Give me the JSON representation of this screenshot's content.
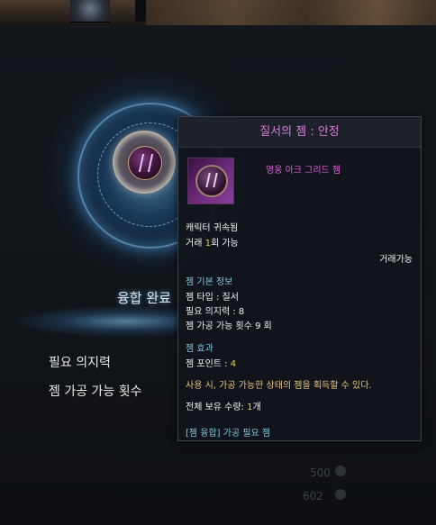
{
  "background": {
    "fusion_status": "융합 완료",
    "stats": [
      "필요 의지력",
      "젬 가공 가능 횟수"
    ],
    "faint_values": [
      "500",
      "602"
    ]
  },
  "tooltip": {
    "title": "질서의 젬 : 안정",
    "grade": "영웅 아크 그리드 젬",
    "bound": "캐릭터 귀속됨",
    "trade_count_prefix": "거래 ",
    "trade_count_value": "1",
    "trade_count_suffix": "회 가능",
    "tradeable": "거래가능",
    "basic_info_header": "젬 기본 정보",
    "gem_type": "젬 타입 : 질서",
    "required_willpower": "필요 의지력 : 8",
    "process_count": "젬 가공 가능 횟수 9 회",
    "effect_header": "젬 효과",
    "gem_point_label": "젬 포인트 : ",
    "gem_point_value": "4",
    "use_text": "사용 시, 가공 가능한 상태의 젬을 획득할 수 있다.",
    "owned_label": "전체 보유 수량: ",
    "owned_value": "1",
    "owned_suffix": "개",
    "link": "[젬 융합] 가공 필요 젬"
  },
  "colors": {
    "title": "#d97ad9",
    "grade": "#e35ee3",
    "section_header": "#7fc4d8",
    "highlight": "#f2d24a",
    "use_text": "#e3c377",
    "glow": "#78c8ff"
  },
  "icons": [
    "gem-medal-icon",
    "gem-item-icon"
  ]
}
